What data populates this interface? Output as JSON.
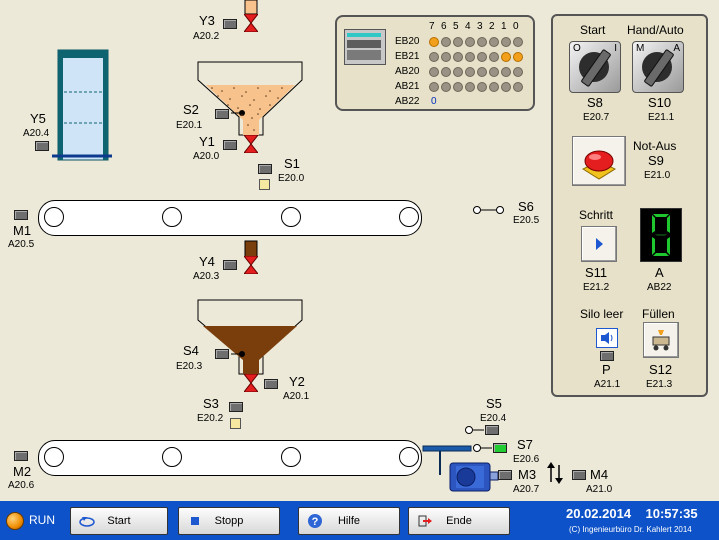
{
  "plant": {
    "y3": {
      "name": "Y3",
      "addr": "A20.2"
    },
    "s2": {
      "name": "S2",
      "addr": "E20.1"
    },
    "y1": {
      "name": "Y1",
      "addr": "A20.0"
    },
    "s1": {
      "name": "S1",
      "addr": "E20.0"
    },
    "y5": {
      "name": "Y5",
      "addr": "A20.4"
    },
    "m1": {
      "name": "M1",
      "addr": "A20.5"
    },
    "s6": {
      "name": "S6",
      "addr": "E20.5"
    },
    "y4": {
      "name": "Y4",
      "addr": "A20.3"
    },
    "s4": {
      "name": "S4",
      "addr": "E20.3"
    },
    "y2": {
      "name": "Y2",
      "addr": "A20.1"
    },
    "s3": {
      "name": "S3",
      "addr": "E20.2"
    },
    "s5": {
      "name": "S5",
      "addr": "E20.4"
    },
    "s7": {
      "name": "S7",
      "addr": "E20.6"
    },
    "m2": {
      "name": "M2",
      "addr": "A20.6"
    },
    "m3": {
      "name": "M3",
      "addr": "A20.7"
    },
    "m4": {
      "name": "M4",
      "addr": "A21.0"
    }
  },
  "io_display": {
    "bit_labels": [
      "7",
      "6",
      "5",
      "4",
      "3",
      "2",
      "1",
      "0"
    ],
    "rows": [
      {
        "name": "EB20",
        "leds": [
          1,
          0,
          0,
          0,
          0,
          0,
          0,
          0
        ]
      },
      {
        "name": "EB21",
        "leds": [
          0,
          0,
          0,
          0,
          0,
          0,
          1,
          1
        ]
      },
      {
        "name": "AB20",
        "leds": [
          0,
          0,
          0,
          0,
          0,
          0,
          0,
          0
        ]
      },
      {
        "name": "AB21",
        "leds": [
          0,
          0,
          0,
          0,
          0,
          0,
          0,
          0
        ]
      }
    ],
    "ab22": {
      "name": "AB22",
      "value": "0"
    }
  },
  "panel": {
    "start": {
      "title": "Start",
      "off": "O",
      "on": "I",
      "name": "S8",
      "addr": "E20.7"
    },
    "handauto": {
      "title": "Hand/Auto",
      "off": "M",
      "on": "A",
      "name": "S10",
      "addr": "E21.1"
    },
    "notaus": {
      "title": "Not-Aus",
      "name": "S9",
      "addr": "E21.0"
    },
    "schritt": {
      "title": "Schritt",
      "name": "S11",
      "addr": "E21.2"
    },
    "display": {
      "name": "A",
      "addr": "AB22",
      "digit": "0"
    },
    "siloleer": {
      "title": "Silo leer",
      "name": "P",
      "addr": "A21.1"
    },
    "fuellen": {
      "title": "Füllen",
      "name": "S12",
      "addr": "E21.3"
    }
  },
  "taskbar": {
    "run": "RUN",
    "buttons": [
      "Start",
      "Stopp",
      "Hilfe",
      "Ende"
    ],
    "datetime": "20.02.2014    10:57:35",
    "copyright": "(C) Ingenieurbüro Dr. Kahlert 2014"
  },
  "colors": {
    "sand": "#f8c28c",
    "brown": "#7a3e0c",
    "valve": "#e41e1e",
    "taskbar": "#0d52c8",
    "led_on": "#f2a01c"
  }
}
